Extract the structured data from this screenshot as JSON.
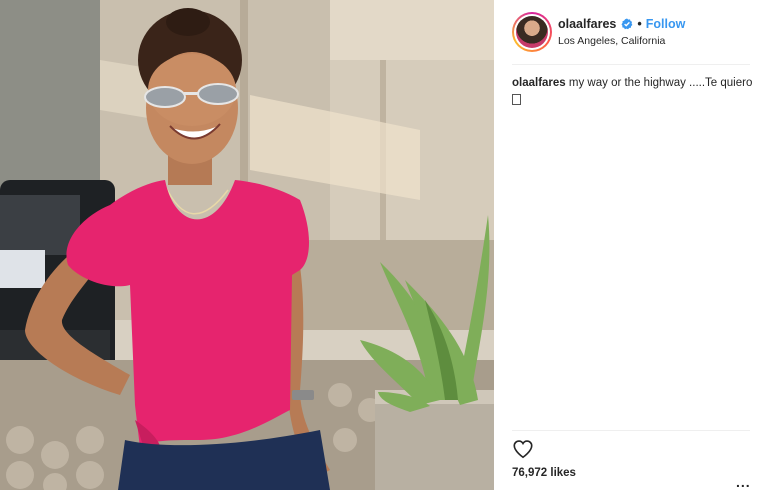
{
  "post": {
    "username": "olaalfares",
    "follow_label": "Follow",
    "separator": "•",
    "location": "Los Angeles, California",
    "caption_user": "olaalfares",
    "caption_text": " my way or the highway .....Te quiero",
    "likes": "76,972 likes",
    "more_label": "..."
  },
  "icons": {
    "verified": "verified-badge-icon",
    "like": "heart-outline-icon",
    "more": "more-options-icon",
    "emoji": "unsupported-emoji-glyph"
  },
  "colors": {
    "follow": "#3897f0",
    "verified": "#3897f0",
    "shirt": "#e6246e"
  }
}
